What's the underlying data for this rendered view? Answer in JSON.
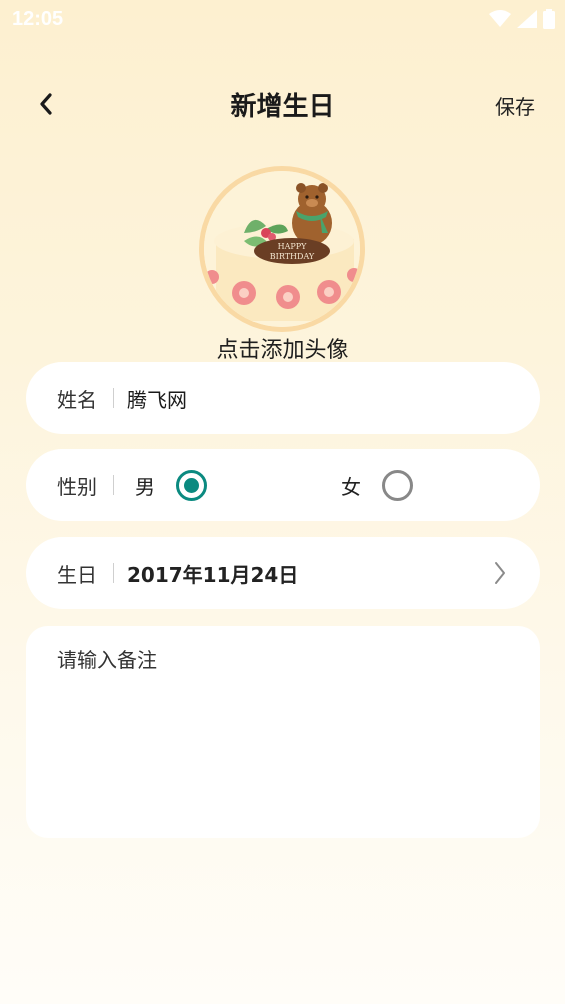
{
  "status_bar": {
    "time": "12:05",
    "icons": [
      "wifi-icon",
      "cellular-icon",
      "battery-icon"
    ]
  },
  "header": {
    "title": "新增生日",
    "save_label": "保存",
    "back_icon": "chevron-left-icon"
  },
  "avatar": {
    "caption": "点击添加头像",
    "cake_text_line1": "HAPPY",
    "cake_text_line2": "BIRTHDAY"
  },
  "form": {
    "name": {
      "label": "姓名",
      "value": "腾飞网"
    },
    "gender": {
      "label": "性别",
      "options": [
        {
          "label": "男",
          "selected": true
        },
        {
          "label": "女",
          "selected": false
        }
      ]
    },
    "birthday": {
      "label": "生日",
      "value": "2017年11月24日"
    },
    "note": {
      "placeholder": "请输入备注"
    }
  },
  "colors": {
    "accent": "#0b8a80",
    "background": "#fdf3d8",
    "card": "#ffffff",
    "avatar_ring": "#f9d9a4"
  }
}
